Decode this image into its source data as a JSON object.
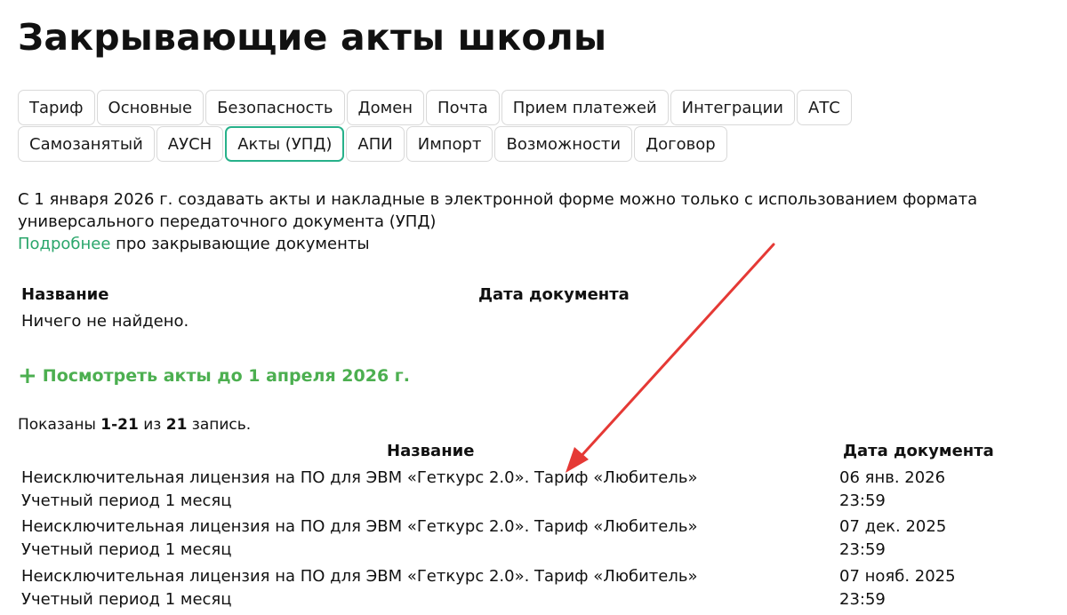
{
  "page": {
    "title": "Закрывающие акты школы"
  },
  "tabs": {
    "row1": [
      {
        "label": "Тариф"
      },
      {
        "label": "Основные"
      },
      {
        "label": "Безопасность"
      },
      {
        "label": "Домен"
      },
      {
        "label": "Почта"
      },
      {
        "label": "Прием платежей"
      },
      {
        "label": "Интеграции"
      },
      {
        "label": "АТС"
      }
    ],
    "row2": [
      {
        "label": "Самозанятый"
      },
      {
        "label": "АУСН"
      },
      {
        "label": "Акты (УПД)",
        "active": true
      },
      {
        "label": "АПИ"
      },
      {
        "label": "Импорт"
      },
      {
        "label": "Возможности"
      },
      {
        "label": "Договор"
      }
    ]
  },
  "notice": {
    "text": "С 1 января 2026 г. создавать акты и накладные в электронной форме можно только с использованием формата универсального передаточного документа (УПД)",
    "link_label": "Подробнее",
    "link_suffix": " про закрывающие документы"
  },
  "table1": {
    "col_name": "Название",
    "col_date": "Дата документа",
    "empty": "Ничего не найдено."
  },
  "show_more": {
    "icon": "plus-icon",
    "label": "Посмотреть акты до 1 апреля 2026 г."
  },
  "summary": {
    "prefix": "Показаны ",
    "range": "1-21",
    "middle": " из ",
    "total": "21",
    "suffix": " запись."
  },
  "table2": {
    "col_name": "Название",
    "col_date": "Дата документа",
    "rows": [
      {
        "name": "Неисключительная лицензия на ПО для ЭВМ «Геткурс 2.0». Тариф «Любитель»",
        "period": "Учетный период 1 месяц",
        "date": "06 янв. 2026",
        "time": "23:59"
      },
      {
        "name": "Неисключительная лицензия на ПО для ЭВМ «Геткурс 2.0». Тариф «Любитель»",
        "period": "Учетный период 1 месяц",
        "date": "07 дек. 2025",
        "time": "23:59"
      },
      {
        "name": "Неисключительная лицензия на ПО для ЭВМ «Геткурс 2.0». Тариф «Любитель»",
        "period": "Учетный период 1 месяц",
        "date": "07 нояб. 2025",
        "time": "23:59"
      }
    ]
  },
  "colors": {
    "accent": "#27b18a",
    "link": "#2aa66b",
    "show_more": "#4caf50",
    "annotation_arrow": "#e53935"
  }
}
